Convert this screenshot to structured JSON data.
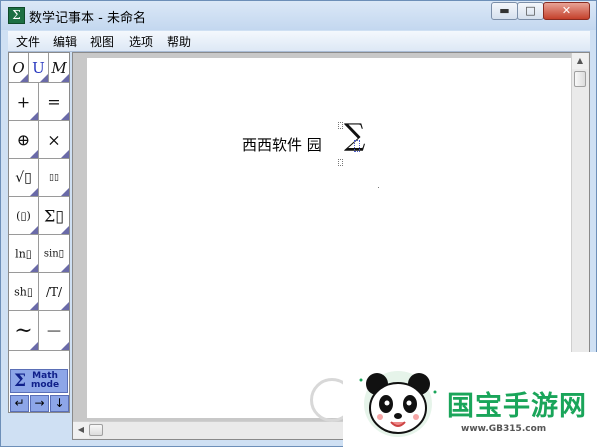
{
  "window": {
    "title": "数学记事本 - 未命名",
    "app_icon": "Σ",
    "controls": {
      "minimize": "▬",
      "maximize": "□",
      "close": "✕"
    }
  },
  "menu": [
    "文件",
    "编辑",
    "视图",
    "选项",
    "帮助"
  ],
  "palette": {
    "cells": [
      "O",
      "U",
      "M",
      "+",
      "=",
      "⊕",
      "×",
      "√▯",
      "▯▯",
      "(▯)",
      "Σ▯",
      "ln▯",
      "sin▯",
      "sh▯",
      "/T/",
      "~",
      "—"
    ],
    "math_mode": {
      "symbol": "Σ",
      "line1": "Math",
      "line2": "mode"
    },
    "nav": [
      "↵",
      "→",
      "↓"
    ]
  },
  "document": {
    "text": "西西软件 园",
    "summation": "∑"
  },
  "watermark": {
    "title": "国宝手游网",
    "url": "www.GB315.com"
  },
  "colors": {
    "accent_purple": "#8da6e8",
    "watermark_green": "#1aa55a"
  }
}
